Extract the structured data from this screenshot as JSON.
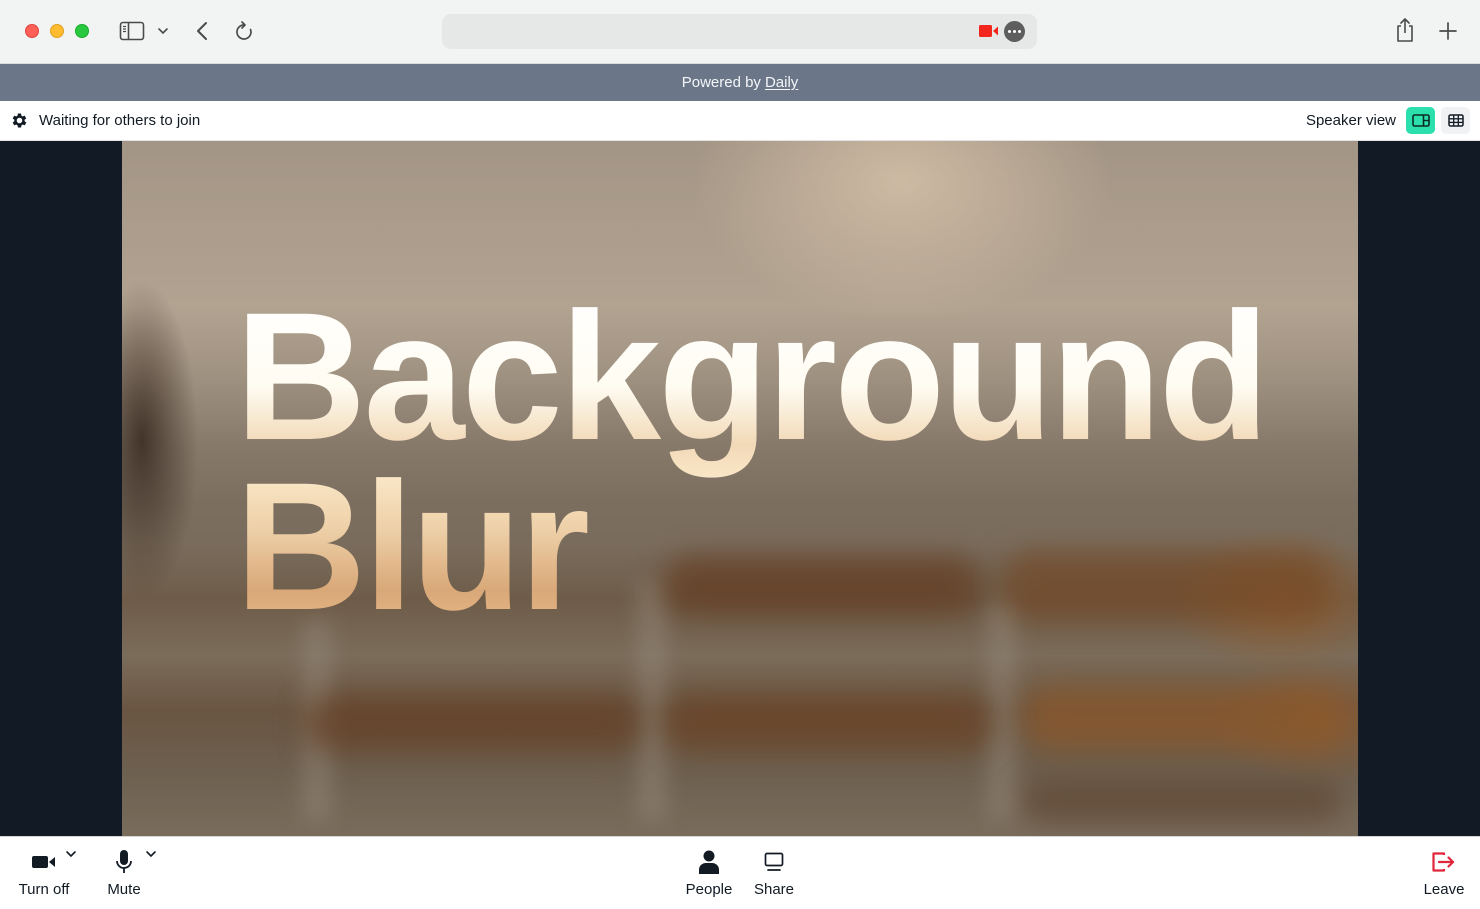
{
  "browser": {
    "address_bar_value": "",
    "address_indicators": [
      "camera-in-use-icon",
      "more-options-icon"
    ],
    "toolbar_icons": [
      "sidebar-icon",
      "chevron-down-icon",
      "back-icon",
      "reload-icon",
      "share-icon",
      "new-tab-icon"
    ]
  },
  "banner": {
    "prefix": "Powered by",
    "link_label": "Daily"
  },
  "topbar": {
    "status_text": "Waiting for others to join",
    "view_label": "Speaker view",
    "views": [
      {
        "name": "speaker",
        "icon": "speaker-view-icon",
        "active": true
      },
      {
        "name": "grid",
        "icon": "grid-view-icon",
        "active": false
      }
    ]
  },
  "video": {
    "overlay_line1": "Background",
    "overlay_line2": "Blur"
  },
  "tray": {
    "camera_label": "Turn off",
    "mic_label": "Mute",
    "people_label": "People",
    "share_label": "Share",
    "leave_label": "Leave"
  },
  "colors": {
    "banner_bg": "#6b7789",
    "active_view_accent": "#2be0ad",
    "stage_bg": "#121a25",
    "leave_red": "#e0263a",
    "recording_red": "#f2261c"
  }
}
